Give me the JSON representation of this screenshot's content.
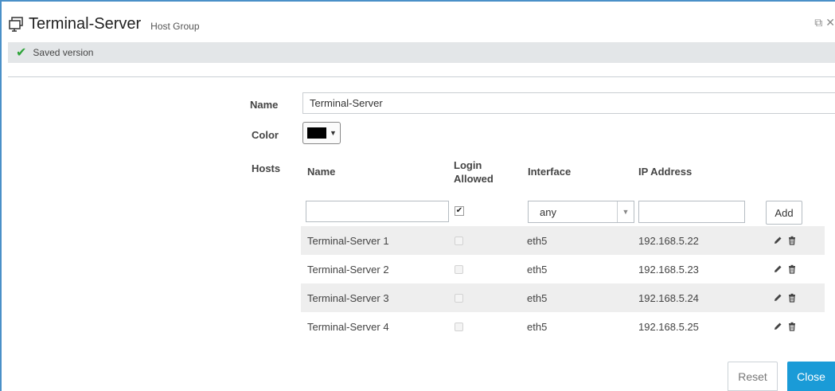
{
  "window": {
    "title": "Terminal-Server",
    "subtitle": "Host Group",
    "icons": {
      "window": "window-stack-icon",
      "restore": "restore-icon",
      "close": "close-icon"
    },
    "restore_glyph": "⧉",
    "close_glyph": "✕"
  },
  "status": {
    "text": "Saved version",
    "icon": "checkmark-icon",
    "icon_glyph": "✔"
  },
  "form": {
    "name_label": "Name",
    "name_value": "Terminal-Server",
    "color_label": "Color",
    "color_value": "#000000",
    "hosts_label": "Hosts"
  },
  "hosts_table": {
    "columns": [
      "Name",
      "Login Allowed",
      "Interface",
      "IP Address"
    ],
    "new_row": {
      "name": "",
      "login_allowed": true,
      "interface": "any",
      "ip": "",
      "add_label": "Add"
    },
    "rows": [
      {
        "name": "Terminal-Server 1",
        "login_allowed": false,
        "interface": "eth5",
        "ip": "192.168.5.22"
      },
      {
        "name": "Terminal-Server 2",
        "login_allowed": false,
        "interface": "eth5",
        "ip": "192.168.5.23"
      },
      {
        "name": "Terminal-Server 3",
        "login_allowed": false,
        "interface": "eth5",
        "ip": "192.168.5.24"
      },
      {
        "name": "Terminal-Server 4",
        "login_allowed": false,
        "interface": "eth5",
        "ip": "192.168.5.25"
      }
    ]
  },
  "footer": {
    "reset_label": "Reset",
    "close_label": "Close"
  },
  "colors": {
    "accent": "#1a9bd7",
    "saved_check": "#2ea43a",
    "status_bg": "#e3e6e8",
    "row_shade": "#eeeeee"
  }
}
